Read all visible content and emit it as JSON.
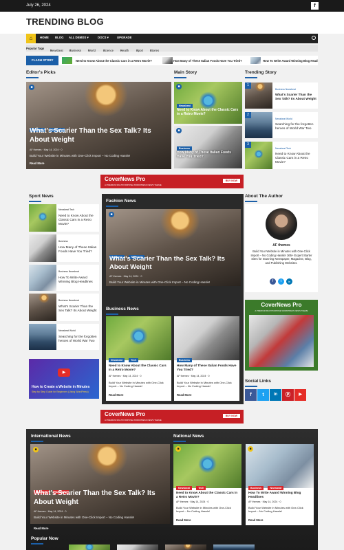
{
  "topbar": {
    "date": "July 26, 2024",
    "fb": "f"
  },
  "brand": {
    "logo": "TRENDING BLOG"
  },
  "nav": {
    "home_icon": "home-icon",
    "items": [
      "BLOG",
      "ALL DEMOS",
      "DOCS",
      "UPGRADE"
    ],
    "dropdown_arrow": "▾"
  },
  "tags": {
    "label": "Popular Tags",
    "items": [
      "Newsbeat",
      "Business",
      "World",
      "Science",
      "Health",
      "Sport",
      "Stories"
    ],
    "marker": "#"
  },
  "ticker": {
    "label": "FLASH STORY",
    "items": [
      "Need to Know About the Classic Cars in a Retro Movie?",
      "How Many of These Italian Foods Have You Tried?",
      "How To Write Award Winning Blog Headl"
    ]
  },
  "editors": {
    "heading": "Editor's Picks",
    "badges": [
      "Business",
      "Newsbeat"
    ],
    "title": "What's Scarier Than the Sex Talk? Its About Weight",
    "meta": "AF themes  ·  May 14, 2024  ·  0",
    "desc": "Build Your Website in Minutes with One-Click Import – No Coding Hassle!",
    "more": "Read More"
  },
  "main_story": {
    "heading": "Main Story",
    "items": [
      {
        "badge": "Newsbeat",
        "title": "Need to Know About the Classic Cars in a Retro Movie?"
      },
      {
        "badge": "Business",
        "title": "How Many of These Italian Foods Have You Tried?"
      }
    ]
  },
  "trending": {
    "heading": "Trending Story",
    "items": [
      {
        "num": "1",
        "cats": "Business  Newsbeat",
        "title": "What's Scarier Than the Sex Talk? Its About Weight"
      },
      {
        "num": "2",
        "cats": "Newsbeat  World",
        "title": "Searching for the forgotten heroes of World War Two"
      },
      {
        "num": "3",
        "cats": "Newsbeat  Tech",
        "title": "Need to Know About the Classic Cars in a Retro Movie?"
      }
    ]
  },
  "banner": {
    "name": "CoverNews Pro",
    "sub": "A PREMIUM MULTIPURPOSE WORDPRESS NEWS THEME",
    "buy": "BUY NOW"
  },
  "sport": {
    "heading": "Sport News",
    "items": [
      {
        "cats": "Newsbeat  Tech",
        "title": "Need to Know About the Classic Cars in a Retro Movie?"
      },
      {
        "cats": "Business",
        "title": "How Many of These Italian Foods Have You Tried?"
      },
      {
        "cats": "Business  Newsbeat",
        "title": "How To Write Award Winning Blog Headlines"
      },
      {
        "cats": "Business  Newsbeat",
        "title": "What's Scarier Than the Sex Talk? Its About Weight"
      },
      {
        "cats": "Newsbeat  World",
        "title": "Searching for the forgotten heroes of World War Two"
      }
    ],
    "video_title": "How to Create a Website in Minutes",
    "video_sub": "Step by Step Guide for Beginners (Using WordPress)"
  },
  "fashion": {
    "heading": "Fashion News",
    "badges": [
      "Business",
      "Newsbeat"
    ],
    "title": "What's Scarier Than the Sex Talk? Its About Weight",
    "meta": "AF themes  ·  May 14, 2024  ·  0",
    "desc": "Build Your Website in Minutes with One-Click Import – No Coding Hassle!"
  },
  "business": {
    "heading": "Business News",
    "cards": [
      {
        "badges": [
          "Newsbeat",
          "Tech"
        ],
        "title": "Need to Know About the Classic Cars in a Retro Movie?",
        "meta": "AF themes  ·  May 14, 2024  ·  0",
        "desc": "Build Your Website in Minutes with One-Click Import – No Coding Hassle!",
        "more": "Read More"
      },
      {
        "badges": [
          "Business"
        ],
        "title": "How Many of These Italian Foods Have You Tried?",
        "meta": "AF themes  ·  May 14, 2024  ·  0",
        "desc": "Build Your Website in Minutes with One-Click Import – No Coding Hassle!",
        "more": "Read More"
      }
    ]
  },
  "author": {
    "heading": "About The Author",
    "name": "AF themes",
    "bio": "Build Your Website in Minutes with One-Click Import – No Coding Hassle! 365+ Expert Starter Sites for Stunning Newspaper, Magazine, Blog, and Publishing Websites."
  },
  "promo": {
    "name": "CoverNews Pro",
    "sub": "A PREMIUM MULTIPURPOSE WORDPRESS NEWS THEME"
  },
  "social": {
    "heading": "Social Links",
    "icons": [
      "f",
      "t",
      "in",
      "Ⓟ",
      "▶"
    ]
  },
  "international": {
    "heading": "International News",
    "badges": [
      "Business",
      "Newsbeat"
    ],
    "title": "What's Scarier Than the Sex Talk? Its About Weight",
    "meta": "AF themes  ·  May 14, 2024  ·  0",
    "desc": "Build Your Website in Minutes with One-Click Import – No Coding Hassle!",
    "more": "Read More"
  },
  "national": {
    "heading": "National News",
    "cards": [
      {
        "badges": [
          "Newsbeat",
          "Tech"
        ],
        "title": "Need to Know About the Classic Cars in a Retro Movie?",
        "meta": "AF themes  ·  May 14, 2024  ·  0",
        "desc": "Build Your Website in Minutes with One-Click Import – No Coding Hassle!",
        "more": "Read More"
      },
      {
        "badges": [
          "Business",
          "Newsbeat"
        ],
        "title": "How To Write Award Winning Blog Headlines",
        "meta": "AF themes  ·  May 14, 2024  ·  0",
        "desc": "Build Your Website in Minutes with One-Click Import – No Coding Hassle!",
        "more": "Read More"
      }
    ]
  },
  "popular": {
    "heading": "Popular Now"
  }
}
